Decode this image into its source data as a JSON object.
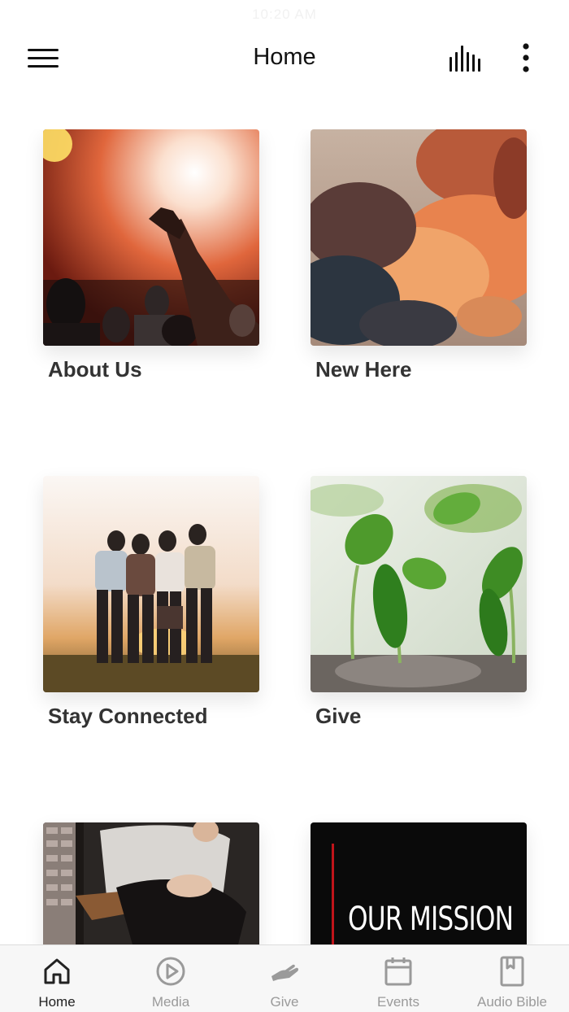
{
  "status_bar": {
    "time": "10:20 AM"
  },
  "header": {
    "title": "Home",
    "menu_icon": "hamburger-menu-icon",
    "audio_icon": "audio-bars-icon",
    "more_icon": "more-vertical-icon"
  },
  "tiles": [
    {
      "label": "About Us",
      "image": "worship-concert-photo"
    },
    {
      "label": "New Here",
      "image": "sunset-clouds-photo"
    },
    {
      "label": "Stay Connected",
      "image": "friends-sunset-photo"
    },
    {
      "label": "Give",
      "image": "plant-sprouts-photo"
    },
    {
      "label": "",
      "image": "man-sitting-photo"
    },
    {
      "label": "",
      "image": "our-mission-graphic",
      "graphic_text": "OUR MISSION"
    }
  ],
  "tab_bar": {
    "active": "Home",
    "items": [
      {
        "label": "Home",
        "icon": "home-icon"
      },
      {
        "label": "Media",
        "icon": "play-circle-icon"
      },
      {
        "label": "Give",
        "icon": "giving-hand-icon"
      },
      {
        "label": "Events",
        "icon": "calendar-icon"
      },
      {
        "label": "Audio Bible",
        "icon": "bible-book-icon"
      }
    ]
  },
  "colors": {
    "accent": "#111111",
    "tab_inactive": "#9a9a9a",
    "tab_active": "#222222",
    "mission_red": "#c0141a"
  }
}
